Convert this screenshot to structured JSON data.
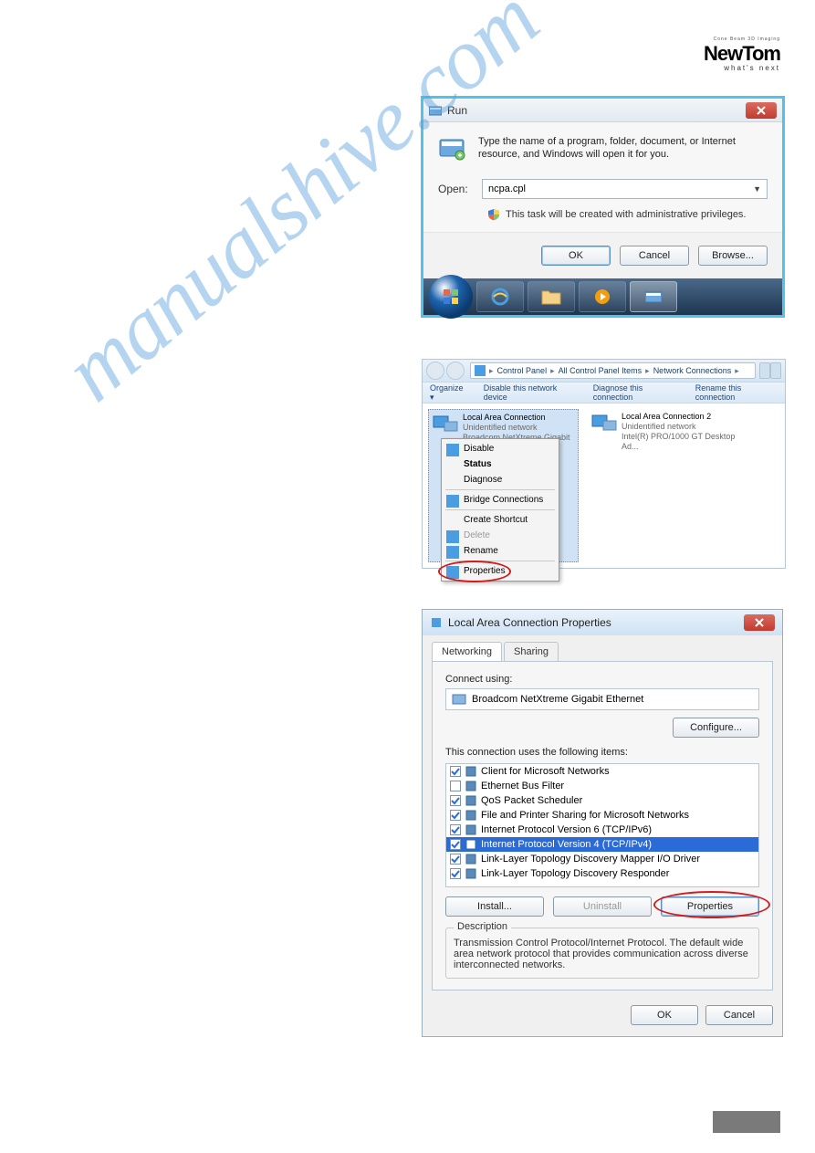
{
  "logo": {
    "topline": "Cone Beam 3D Imaging",
    "main": "NewTom",
    "tagline": "what's next"
  },
  "watermark": "manualshive.com",
  "run_dialog": {
    "title": "Run",
    "instruction": "Type the name of a program, folder, document, or Internet resource, and Windows will open it for you.",
    "open_label": "Open:",
    "open_value": "ncpa.cpl",
    "admin_text": "This task will be created with administrative privileges.",
    "buttons": {
      "ok": "OK",
      "cancel": "Cancel",
      "browse": "Browse..."
    }
  },
  "network_window": {
    "breadcrumb": [
      "Control Panel",
      "All Control Panel Items",
      "Network Connections"
    ],
    "toolbar": {
      "organize": "Organize ▾",
      "disable": "Disable this network device",
      "diagnose": "Diagnose this connection",
      "rename": "Rename this connection"
    },
    "items": [
      {
        "title": "Local Area Connection",
        "status": "Unidentified network",
        "adapter": "Broadcom NetXtreme Gigabit Eth..."
      },
      {
        "title": "Local Area Connection 2",
        "status": "Unidentified network",
        "adapter": "Intel(R) PRO/1000 GT Desktop Ad..."
      }
    ],
    "context_menu": {
      "disable": "Disable",
      "status": "Status",
      "diagnose": "Diagnose",
      "bridge": "Bridge Connections",
      "shortcut": "Create Shortcut",
      "delete": "Delete",
      "rename": "Rename",
      "properties": "Properties"
    }
  },
  "properties_dialog": {
    "title": "Local Area Connection Properties",
    "tabs": {
      "networking": "Networking",
      "sharing": "Sharing"
    },
    "connect_using_label": "Connect using:",
    "adapter": "Broadcom NetXtreme Gigabit Ethernet",
    "configure_btn": "Configure...",
    "items_label": "This connection uses the following items:",
    "items": [
      {
        "checked": true,
        "label": "Client for Microsoft Networks"
      },
      {
        "checked": false,
        "label": "Ethernet Bus Filter"
      },
      {
        "checked": true,
        "label": "QoS Packet Scheduler"
      },
      {
        "checked": true,
        "label": "File and Printer Sharing for Microsoft Networks"
      },
      {
        "checked": true,
        "label": "Internet Protocol Version 6 (TCP/IPv6)"
      },
      {
        "checked": true,
        "label": "Internet Protocol Version 4 (TCP/IPv4)",
        "selected": true
      },
      {
        "checked": true,
        "label": "Link-Layer Topology Discovery Mapper I/O Driver"
      },
      {
        "checked": true,
        "label": "Link-Layer Topology Discovery Responder"
      }
    ],
    "buttons": {
      "install": "Install...",
      "uninstall": "Uninstall",
      "properties": "Properties"
    },
    "description_label": "Description",
    "description_text": "Transmission Control Protocol/Internet Protocol. The default wide area network protocol that provides communication across diverse interconnected networks.",
    "ok": "OK",
    "cancel": "Cancel"
  }
}
